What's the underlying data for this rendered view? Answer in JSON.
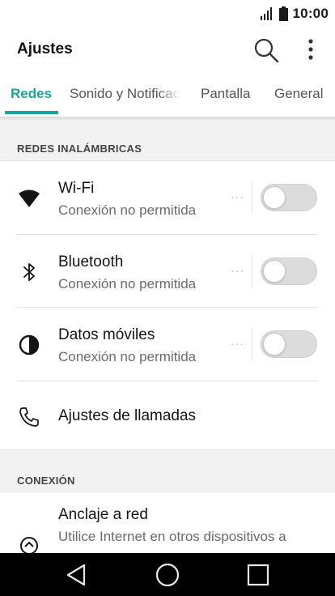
{
  "status_bar": {
    "time": "10:00"
  },
  "app_bar": {
    "title": "Ajustes"
  },
  "tabs": [
    {
      "label": "Redes"
    },
    {
      "label": "Sonido y Notificaciones"
    },
    {
      "label": "Pantalla"
    },
    {
      "label": "General"
    }
  ],
  "sections": {
    "wireless": {
      "title": "REDES INALÁMBRICAS"
    },
    "connection": {
      "title": "CONEXIÓN"
    }
  },
  "wireless_rows": [
    {
      "title": "Wi-Fi",
      "subtitle": "Conexión no permitida",
      "dots": "···",
      "toggle_on": false
    },
    {
      "title": "Bluetooth",
      "subtitle": "Conexión no permitida",
      "dots": "···",
      "toggle_on": false
    },
    {
      "title": "Datos móviles",
      "subtitle": "Conexión no permitida",
      "dots": "···",
      "toggle_on": false
    },
    {
      "title": "Ajustes de llamadas"
    }
  ],
  "connection_rows": [
    {
      "title": "Anclaje a red",
      "subtitle": "Utilice Internet en otros dispositivos a"
    }
  ],
  "icons": {
    "wifi": "wifi-icon",
    "bluetooth": "bluetooth-icon",
    "mobile_data": "mobile-data-icon",
    "calls": "phone-icon",
    "tethering": "tethering-icon",
    "search": "search-icon",
    "more": "more-vert-icon"
  },
  "colors": {
    "accent": "#19a59c",
    "nav_bar": "#000000"
  }
}
